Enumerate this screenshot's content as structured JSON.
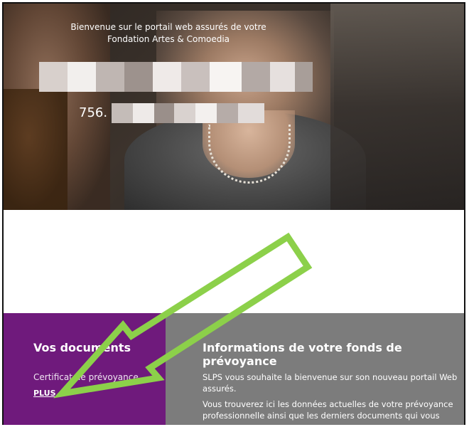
{
  "hero": {
    "welcome_line1": "Bienvenue sur le portail web assurés de votre",
    "welcome_line2": "Fondation Artes & Comoedia",
    "insured_number_prefix": "756."
  },
  "documents": {
    "title": "Vos documents",
    "item_label": "Certificat de prévoyance",
    "more_link": "PLUS",
    "bg_color": "#6f1a7c"
  },
  "info": {
    "title": "Informations de votre fonds de prévoyance",
    "paragraph1": "SLPS vous souhaite la bienvenue sur son nouveau portail Web assurés.",
    "paragraph2": "Vous trouverez ici les données actuelles de votre prévoyance professionnelle ainsi que les derniers documents qui vous",
    "bg_color": "#7c7c7c"
  },
  "annotation": {
    "arrow_color": "#8cd04a"
  }
}
